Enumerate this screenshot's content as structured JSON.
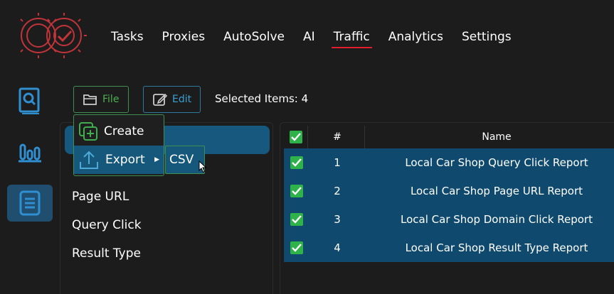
{
  "nav": {
    "items": [
      "Tasks",
      "Proxies",
      "AutoSolve",
      "AI",
      "Traffic",
      "Analytics",
      "Settings"
    ],
    "active": "Traffic"
  },
  "sidebar": {
    "icons": [
      "search-report-icon",
      "bar-chart-icon",
      "document-icon"
    ],
    "active": "document-icon"
  },
  "toolbar": {
    "file_label": "File",
    "edit_label": "Edit",
    "selected_text": "Selected Items: 4"
  },
  "file_menu": {
    "create_label": "Create",
    "export_label": "Export",
    "csv_label": "CSV"
  },
  "left_list": {
    "items": [
      "Page URL",
      "Query Click",
      "Result Type"
    ]
  },
  "table": {
    "columns": [
      "#",
      "Name"
    ],
    "rows": [
      {
        "num": "1",
        "name": "Local Car Shop Query Click Report"
      },
      {
        "num": "2",
        "name": "Local Car Shop Page URL Report"
      },
      {
        "num": "3",
        "name": "Local Car Shop Domain Click Report"
      },
      {
        "num": "4",
        "name": "Local Car Shop Result Type Report"
      }
    ]
  },
  "colors": {
    "accent_blue": "#15587c",
    "active_underline": "#e11d2b",
    "check_green": "#2fb24a",
    "logo_red": "#c0343a"
  }
}
